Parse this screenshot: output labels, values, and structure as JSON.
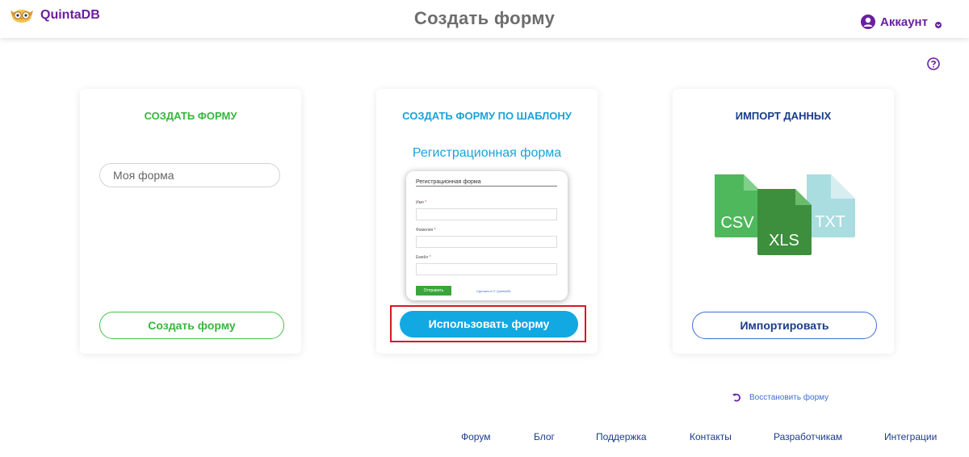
{
  "header": {
    "logo_text": "QuintaDB",
    "title": "Создать форму",
    "account_label": "Аккаунт"
  },
  "cards": {
    "create": {
      "title": "СОЗДАТЬ ФОРМУ",
      "title_color": "#38b63d",
      "input_placeholder": "Моя форма",
      "button_label": "Создать форму"
    },
    "template": {
      "title": "СОЗДАТЬ ФОРМУ ПО ШАБЛОНУ",
      "title_color": "#1aa3d8",
      "template_name": "Регистрационная форма",
      "preview": {
        "title": "Регистрационная форма",
        "fields": [
          "Имя",
          "Фамилия",
          "Емейл"
        ],
        "required_mark": "*",
        "submit_label": "Отправить",
        "made_with": "Сделано в © QuintaDB"
      },
      "button_label": "Использовать форму"
    },
    "import": {
      "title": "ИМПОРТ ДАННЫХ",
      "title_color": "#1a3c8c",
      "file_types": [
        "CSV",
        "XLS",
        "TXT"
      ],
      "button_label": "Импортировать"
    }
  },
  "restore_label": "Восстановить форму",
  "footer": {
    "links": [
      "Форум",
      "Блог",
      "Поддержка",
      "Контакты",
      "Разработчикам",
      "Интеграции"
    ]
  },
  "colors": {
    "brand": "#6a1fa0",
    "primary_button": "#12a8e2",
    "highlight": "#d71920"
  }
}
